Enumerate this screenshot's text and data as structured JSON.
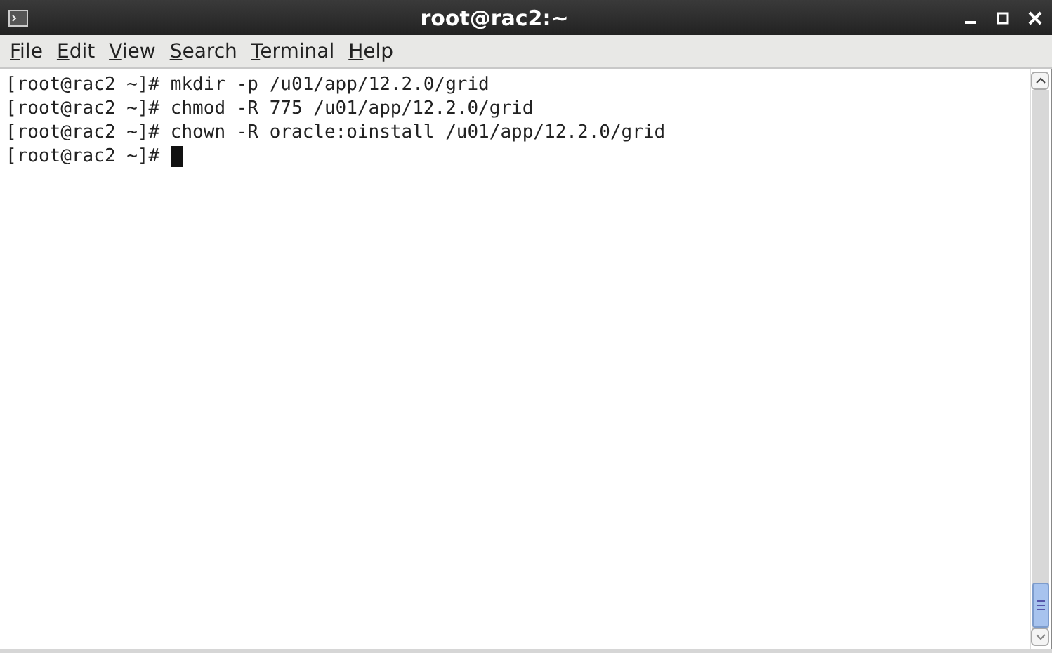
{
  "window": {
    "title": "root@rac2:~"
  },
  "menu": [
    "File",
    "Edit",
    "View",
    "Search",
    "Terminal",
    "Help"
  ],
  "lines": [
    {
      "prompt": "[root@rac2 ~]#",
      "command": "mkdir -p /u01/app/12.2.0/grid",
      "cursor": false
    },
    {
      "prompt": "[root@rac2 ~]#",
      "command": "chmod -R 775 /u01/app/12.2.0/grid",
      "cursor": false
    },
    {
      "prompt": "[root@rac2 ~]#",
      "command": "chown -R oracle:oinstall /u01/app/12.2.0/grid",
      "cursor": false
    },
    {
      "prompt": "[root@rac2 ~]#",
      "cursor": true
    }
  ]
}
